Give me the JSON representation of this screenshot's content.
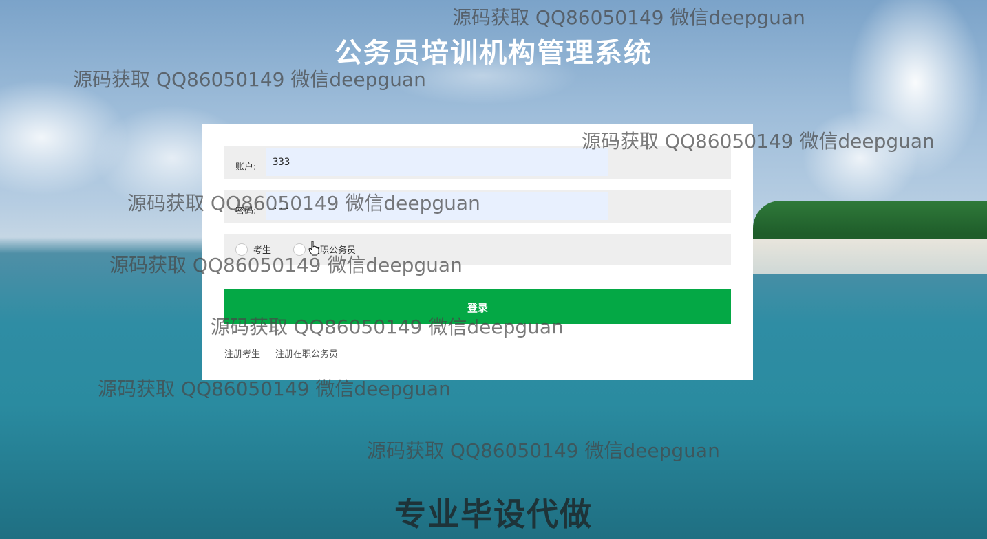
{
  "app": {
    "title": "公务员培训机构管理系统"
  },
  "login_form": {
    "account_label": "账户:",
    "account_value": "333",
    "password_label": "密码:",
    "password_value": "...",
    "role_options": [
      "考生",
      "在职公务员"
    ],
    "submit_label": "登录",
    "register_links": [
      "注册考生",
      "注册在职公务员"
    ]
  },
  "watermarks": [
    "源码获取 QQ86050149 微信deepguan",
    "源码获取 QQ86050149 微信deepguan",
    "源码获取 QQ86050149 微信deepguan",
    "源码获取 QQ86050149 微信deepguan",
    "源码获取 QQ86050149 微信deepguan",
    "源码获取 QQ86050149 微信deepguan",
    "源码获取 QQ86050149 微信deepguan",
    "源码获取 QQ86050149 微信deepguan"
  ],
  "footer_banner": "专业毕设代做",
  "icons": {
    "cursor": "hand-pointer-icon"
  },
  "colors": {
    "primary_button": "#04a845",
    "input_background": "#e8f0fe",
    "field_row_background": "#eeeeee"
  }
}
